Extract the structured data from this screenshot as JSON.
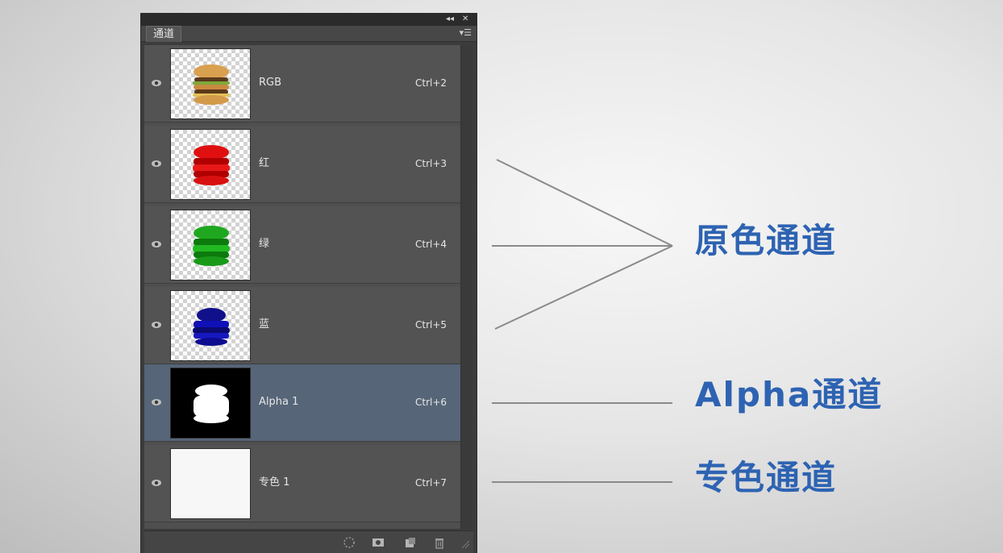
{
  "panel": {
    "tab_label": "通道",
    "collapse_icon": "double-chevron-left-icon",
    "close_icon": "close-icon",
    "menu_icon": "panel-menu-icon"
  },
  "channels": [
    {
      "name": "RGB",
      "shortcut": "Ctrl+2",
      "thumb": "rgb",
      "selected": false
    },
    {
      "name": "红",
      "shortcut": "Ctrl+3",
      "thumb": "red",
      "selected": false
    },
    {
      "name": "绿",
      "shortcut": "Ctrl+4",
      "thumb": "green",
      "selected": false
    },
    {
      "name": "蓝",
      "shortcut": "Ctrl+5",
      "thumb": "blue",
      "selected": false
    },
    {
      "name": "Alpha 1",
      "shortcut": "Ctrl+6",
      "thumb": "alpha",
      "selected": true
    },
    {
      "name": "专色 1",
      "shortcut": "Ctrl+7",
      "thumb": "spot",
      "selected": false
    }
  ],
  "footer_icons": [
    "load-selection-icon",
    "save-selection-icon",
    "new-channel-icon",
    "delete-channel-icon"
  ],
  "annotations": {
    "primary": "原色通道",
    "alpha": "Alpha通道",
    "spot": "专色通道"
  },
  "colors": {
    "annotation": "#2d63b2",
    "selected_row": "#566578",
    "row": "#535353"
  }
}
